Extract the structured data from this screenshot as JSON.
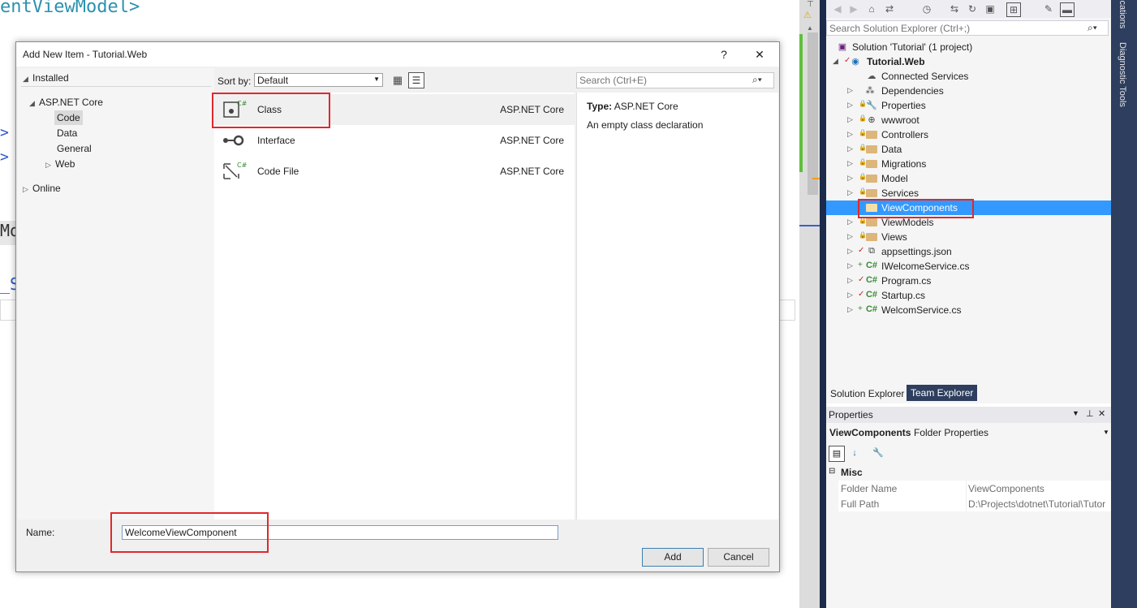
{
  "editor": {
    "code_top": "entViewModel>",
    "code_gt1": ">",
    "code_gt2": ">",
    "code_mo": "Mo",
    "code_s": "_S"
  },
  "dialog": {
    "title": "Add New Item - Tutorial.Web",
    "help_label": "?",
    "close_label": "✕",
    "left_tree": {
      "installed": "Installed",
      "aspnet_core": "ASP.NET Core",
      "code": "Code",
      "data": "Data",
      "general": "General",
      "web": "Web",
      "online": "Online"
    },
    "sort_by_label": "Sort by:",
    "sort_by_value": "Default",
    "search_placeholder": "Search (Ctrl+E)",
    "templates": [
      {
        "name": "Class",
        "category": "ASP.NET Core"
      },
      {
        "name": "Interface",
        "category": "ASP.NET Core"
      },
      {
        "name": "Code File",
        "category": "ASP.NET Core"
      }
    ],
    "detail": {
      "type_label": "Type:",
      "type_value": "ASP.NET Core",
      "description": "An empty class declaration"
    },
    "name_label": "Name:",
    "name_value": "WelcomeViewComponent",
    "add_label": "Add",
    "cancel_label": "Cancel"
  },
  "solution_explorer": {
    "search_placeholder": "Search Solution Explorer (Ctrl+;)",
    "solution": "Solution 'Tutorial' (1 project)",
    "project": "Tutorial.Web",
    "items": [
      "Connected Services",
      "Dependencies",
      "Properties",
      "wwwroot",
      "Controllers",
      "Data",
      "Migrations",
      "Model",
      "Services",
      "ViewComponents",
      "ViewModels",
      "Views",
      "appsettings.json",
      "IWelcomeService.cs",
      "Program.cs",
      "Startup.cs",
      "WelcomService.cs"
    ],
    "selected_item": "ViewComponents",
    "tab_solution": "Solution Explorer",
    "tab_team": "Team Explorer"
  },
  "properties": {
    "title": "Properties",
    "object_name": "ViewComponents",
    "object_type": "Folder Properties",
    "category": "Misc",
    "rows": [
      {
        "name": "Folder Name",
        "value": "ViewComponents"
      },
      {
        "name": "Full Path",
        "value": "D:\\Projects\\dotnet\\Tutorial\\Tutor"
      }
    ]
  },
  "side_tabs": {
    "tab1": "ications",
    "tab2": "Diagnostic Tools"
  },
  "colors": {
    "accent_selection": "#3399ff",
    "highlight_box": "#e0282c",
    "dark_frame": "#2d3e5e"
  }
}
